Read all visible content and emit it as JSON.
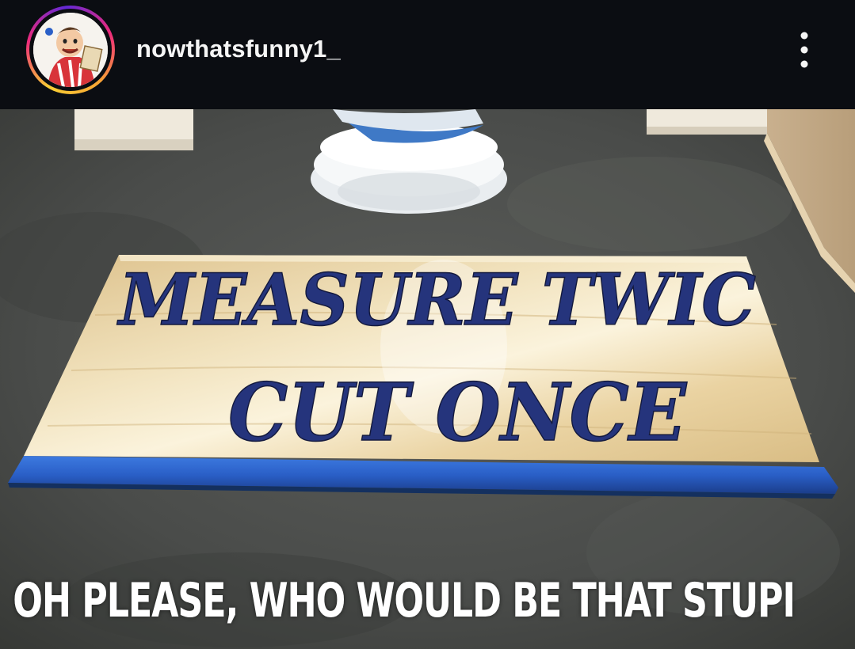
{
  "post": {
    "username": "nowthatsfunny1_"
  },
  "image": {
    "sign_line_1": "MEASURE TWIC",
    "sign_line_2": "CUT ONCE",
    "caption": "OH PLEASE, WHO WOULD BE THAT STUPI"
  },
  "icons": {
    "avatar": "cartoon-avatar",
    "menu": "more-options-icon"
  },
  "colors": {
    "header_bg": "#0b0d12",
    "sign_wood": "#e8d5a6",
    "sign_letters": "#25347c",
    "sign_trim": "#2a5fc7",
    "floor": "#4a4c4a"
  }
}
